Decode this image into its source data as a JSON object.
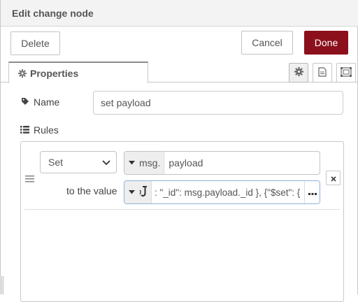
{
  "dialog": {
    "title": "Edit change node"
  },
  "buttons": {
    "delete": "Delete",
    "cancel": "Cancel",
    "done": "Done"
  },
  "tabs": {
    "properties": "Properties"
  },
  "form": {
    "name_label": "Name",
    "name_value": "set payload",
    "rules_label": "Rules"
  },
  "rule": {
    "action": "Set",
    "target_type": "msg.",
    "target_value": "payload",
    "to_label": "to the value",
    "value_type_icon": "expression-icon",
    "value_expression": ": \"_id\": msg.payload._id }, {\"$set\": {"
  },
  "colors": {
    "accent": "#8c101c",
    "border": "#c8c8c8",
    "focus": "#8fb1d8"
  }
}
